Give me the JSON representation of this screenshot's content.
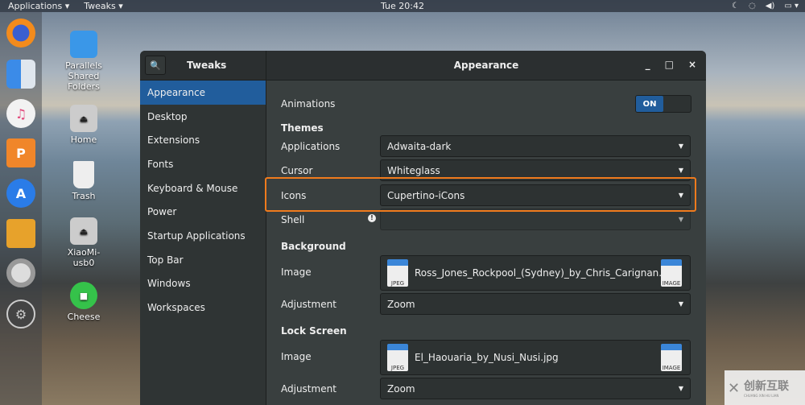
{
  "topbar": {
    "applications": "Applications ▾",
    "tweaks": "Tweaks ▾",
    "clock": "Tue 20:42",
    "tray": [
      "☾",
      "◌",
      "◀)",
      "▭ ▾"
    ]
  },
  "dock": {
    "items": [
      "firefox",
      "finder",
      "music",
      "presentation",
      "app-store",
      "archive",
      "help",
      "settings"
    ]
  },
  "desktop": {
    "items": [
      "Parallels Shared Folders",
      "Home",
      "Trash",
      "XiaoMi-usb0",
      "Cheese"
    ]
  },
  "window": {
    "app_title": "Tweaks",
    "page_title": "Appearance",
    "controls": [
      "_",
      "□",
      "×"
    ]
  },
  "sidebar": {
    "items": [
      "Appearance",
      "Desktop",
      "Extensions",
      "Fonts",
      "Keyboard & Mouse",
      "Power",
      "Startup Applications",
      "Top Bar",
      "Windows",
      "Workspaces"
    ],
    "active": "Appearance"
  },
  "main": {
    "animations_label": "Animations",
    "animations_state": "ON",
    "themes_heading": "Themes",
    "applications_label": "Applications",
    "applications_value": "Adwaita-dark",
    "cursor_label": "Cursor",
    "cursor_value": "Whiteglass",
    "icons_label": "Icons",
    "icons_value": "Cupertino-iCons",
    "shell_label": "Shell",
    "shell_value": "",
    "background_heading": "Background",
    "bg_image_label": "Image",
    "bg_image_value": "Ross_Jones_Rockpool_(Sydney)_by_Chris_Carignan.jpg",
    "bg_adjust_label": "Adjustment",
    "bg_adjust_value": "Zoom",
    "lock_heading": "Lock Screen",
    "ls_image_label": "Image",
    "ls_image_value": "El_Haouaria_by_Nusi_Nusi.jpg",
    "ls_adjust_label": "Adjustment",
    "ls_adjust_value": "Zoom",
    "jpeg_badge": "JPEG",
    "image_badge": "IMAGE"
  },
  "watermark": {
    "cn": "创新互联",
    "en": "CHUANG XIN HU LIAN"
  },
  "colors": {
    "accent": "#215d9c",
    "highlight": "#f07b1d"
  }
}
